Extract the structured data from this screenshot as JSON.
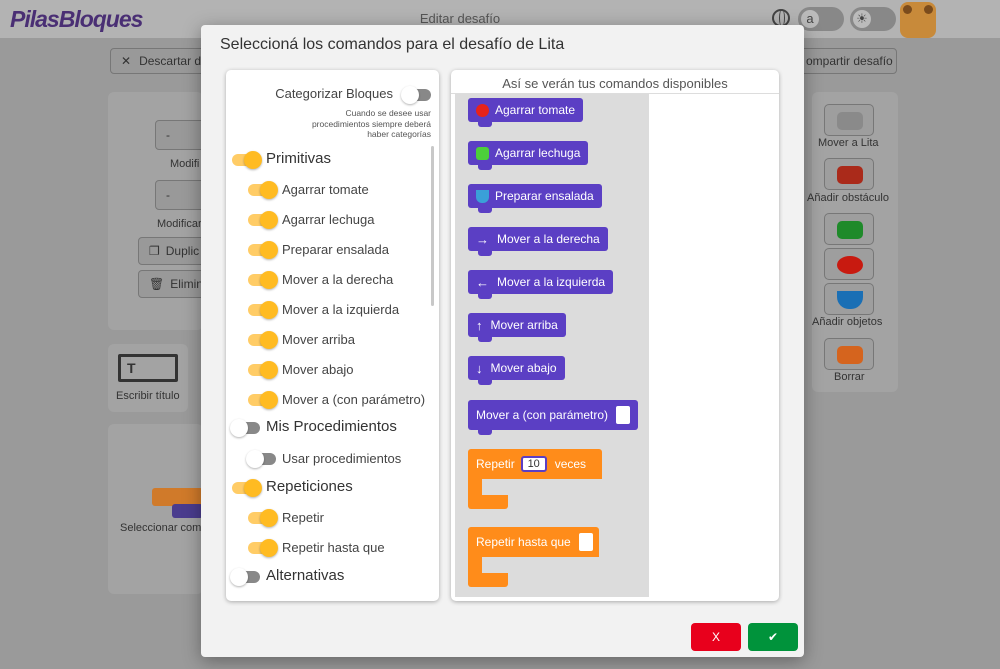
{
  "app": {
    "logo": "PilasBloques",
    "title": "Editar desafío",
    "text_size_label": "a",
    "theme_icon": "sun-icon"
  },
  "background": {
    "discard_label": "Descartar de",
    "share_label": "ompartir desafío",
    "modify_label_1": "Modifi",
    "modify_label_2": "Modificar",
    "minus_1": "-",
    "minus_2": "-",
    "duplicate_label": "Duplic",
    "delete_label": "Elimin",
    "write_title_label": "Escribir título",
    "select_commands_label": "Seleccionar com",
    "tools": {
      "move_lita": "Mover a Lita",
      "add_obstacle": "Añadir obstáculo",
      "add_objects": "Añadir objetos",
      "erase": "Borrar"
    }
  },
  "modal": {
    "title": "Seleccioná los comandos para el desafío de Lita",
    "categorize_label": "Categorizar Bloques",
    "categorize_hint": "Cuando se desee usar procedimientos siempre deberá haber categorías",
    "categories": [
      {
        "name": "Primitivas",
        "on": true
      },
      {
        "name": "Mis Procedimientos",
        "on": false
      },
      {
        "name": "Repeticiones",
        "on": true
      },
      {
        "name": "Alternativas",
        "on": false
      }
    ],
    "items": [
      {
        "name": "Agarrar tomate",
        "on": true
      },
      {
        "name": "Agarrar lechuga",
        "on": true
      },
      {
        "name": "Preparar ensalada",
        "on": true
      },
      {
        "name": "Mover a la derecha",
        "on": true
      },
      {
        "name": "Mover a la izquierda",
        "on": true
      },
      {
        "name": "Mover arriba",
        "on": true
      },
      {
        "name": "Mover abajo",
        "on": true
      },
      {
        "name": "Mover a (con parámetro)",
        "on": true
      },
      {
        "name": "Usar procedimientos",
        "on": false
      },
      {
        "name": "Repetir",
        "on": true
      },
      {
        "name": "Repetir hasta que",
        "on": true
      }
    ],
    "preview_caption": "Así se verán tus comandos disponibles",
    "blocks": {
      "tomato": "Agarrar tomate",
      "lettuce": "Agarrar lechuga",
      "salad": "Preparar ensalada",
      "right": "Mover a la derecha",
      "left": "Mover a la izquierda",
      "up": "Mover arriba",
      "down": "Mover abajo",
      "move_param": "Mover a (con parámetro)",
      "repeat": "Repetir",
      "repeat_times_value": "10",
      "repeat_times_suffix": "veces",
      "repeat_until": "Repetir hasta que"
    },
    "cancel_label": "X",
    "ok_label": "✔"
  },
  "colors": {
    "primitive_block": "#5b3fc4",
    "control_block": "#ff8c1a",
    "toggle_on": "#ffbb22",
    "cancel": "#e8001c",
    "confirm": "#00933b"
  }
}
